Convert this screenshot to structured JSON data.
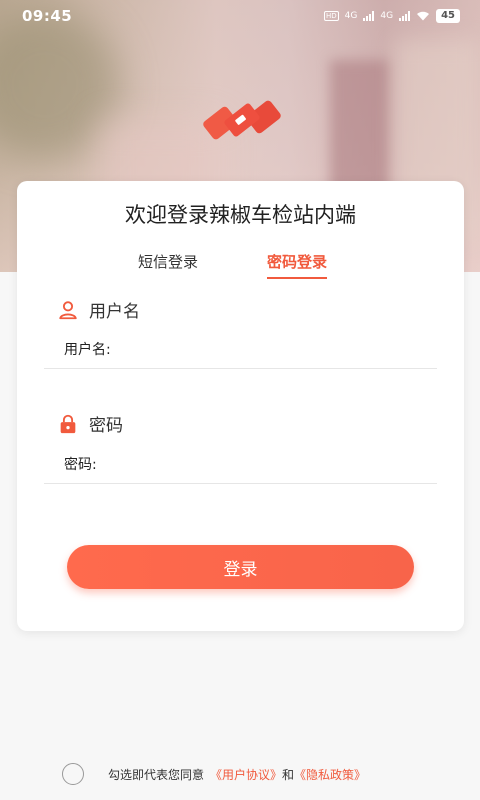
{
  "status_bar": {
    "time": "09:45",
    "hd_label": "HD",
    "net1": "4G",
    "net2": "4G",
    "battery": "45"
  },
  "card": {
    "title": "欢迎登录辣椒车检站内端"
  },
  "tabs": [
    {
      "label": "短信登录",
      "active": false
    },
    {
      "label": "密码登录",
      "active": true
    }
  ],
  "username": {
    "icon": "user-icon",
    "label": "用户名",
    "input_prefix": "用户名:",
    "value": ""
  },
  "password": {
    "icon": "lock-icon",
    "label": "密码",
    "input_prefix": "密码:",
    "value": ""
  },
  "login_button": "登录",
  "agreement": {
    "checked": false,
    "text": "勾选即代表您同意",
    "user_agreement": "《用户协议》",
    "and": "和",
    "privacy_policy": "《隐私政策》"
  },
  "colors": {
    "accent": "#f15a3d",
    "button": "#ff6a4d",
    "background": "#f7f7f7"
  }
}
